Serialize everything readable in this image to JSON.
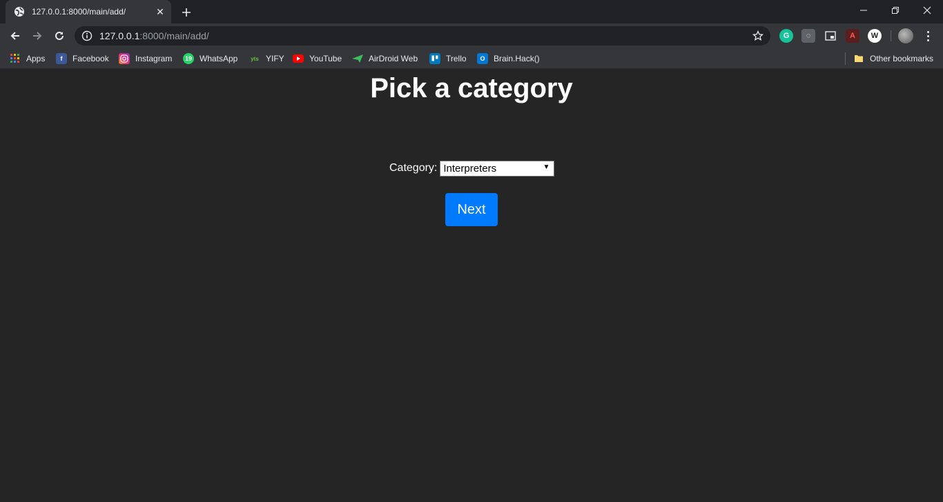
{
  "browser": {
    "tab": {
      "title": "127.0.0.1:8000/main/add/",
      "favicon": "globe-icon"
    },
    "address": {
      "host": "127.0.0.1",
      "path": ":8000/main/add/"
    },
    "extensions": [
      "grammarly-icon",
      "lightbulb-icon",
      "picture-in-picture-icon",
      "pdf-icon",
      "w-extension-icon"
    ],
    "bookmarks": [
      {
        "label": "Apps",
        "icon": "apps-grid-icon"
      },
      {
        "label": "Facebook",
        "icon": "facebook-icon",
        "color": "#3b5998"
      },
      {
        "label": "Instagram",
        "icon": "instagram-icon",
        "color": "#c13584"
      },
      {
        "label": "WhatsApp",
        "icon": "whatsapp-icon",
        "color": "#25d366"
      },
      {
        "label": "YIFY",
        "icon": "yify-icon",
        "color": "#6ac045"
      },
      {
        "label": "YouTube",
        "icon": "youtube-icon",
        "color": "#ff0000"
      },
      {
        "label": "AirDroid Web",
        "icon": "airdroid-icon",
        "color": "#3ebf5c"
      },
      {
        "label": "Trello",
        "icon": "trello-icon",
        "color": "#0079bf"
      },
      {
        "label": "Brain.Hack()",
        "icon": "outlook-icon",
        "color": "#0078d4"
      }
    ],
    "other_bookmarks": "Other bookmarks"
  },
  "page": {
    "title": "Pick a category",
    "category_label": "Category:",
    "category_selected": "Interpreters",
    "next_label": "Next",
    "accent": "#007bff",
    "background": "#252525"
  }
}
